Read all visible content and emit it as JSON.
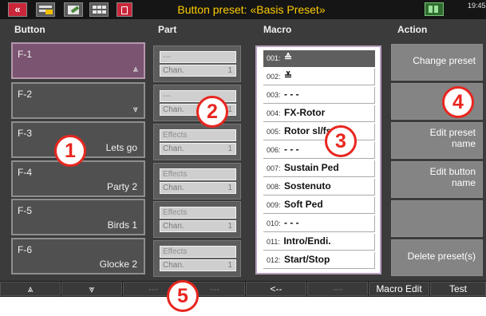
{
  "topbar": {
    "title": "Button preset: «Basis Preset»",
    "clock": "19:45",
    "back_glyph": "«",
    "icons": [
      "back-icon",
      "menu-edit-icon",
      "edit-icon",
      "grid-icon",
      "trash-icon",
      "network-icon"
    ]
  },
  "columns": {
    "button": "Button",
    "part": "Part",
    "macro": "Macro",
    "action": "Action"
  },
  "buttons": [
    {
      "name": "F-1",
      "desc": "",
      "icon": "chevron-double-up-icon",
      "glyph": "⩓",
      "selected": true
    },
    {
      "name": "F-2",
      "desc": "",
      "icon": "chevron-double-down-icon",
      "glyph": "⩔",
      "selected": false
    },
    {
      "name": "F-3",
      "desc": "Lets go"
    },
    {
      "name": "F-4",
      "desc": "Party 2"
    },
    {
      "name": "F-5",
      "desc": "Birds 1"
    },
    {
      "name": "F-6",
      "desc": "Glocke 2"
    }
  ],
  "parts": [
    {
      "top": "---",
      "label": "Chan.",
      "value": "1"
    },
    {
      "top": "---",
      "label": "Chan.",
      "value": "1"
    },
    {
      "top": "Effects",
      "label": "Chan.",
      "value": "1"
    },
    {
      "top": "Effects",
      "label": "Chan.",
      "value": "1"
    },
    {
      "top": "Effects",
      "label": "Chan.",
      "value": "1"
    },
    {
      "top": "Effects",
      "label": "Chan.",
      "value": "1"
    }
  ],
  "macros": [
    {
      "num": "001:",
      "name": "≙",
      "icon": "chevron-double-up-icon",
      "selected": true
    },
    {
      "num": "002:",
      "name": "≚",
      "icon": "chevron-double-down-icon"
    },
    {
      "num": "003:",
      "name": "- - -"
    },
    {
      "num": "004:",
      "name": "FX-Rotor"
    },
    {
      "num": "005:",
      "name": "Rotor sl/fs"
    },
    {
      "num": "006:",
      "name": "- - -"
    },
    {
      "num": "007:",
      "name": "Sustain Ped"
    },
    {
      "num": "008:",
      "name": "Sostenuto"
    },
    {
      "num": "009:",
      "name": "Soft Ped"
    },
    {
      "num": "010:",
      "name": "- - -"
    },
    {
      "num": "011:",
      "name": "Intro/Endi."
    },
    {
      "num": "012:",
      "name": "Start/Stop"
    }
  ],
  "actions": [
    {
      "line1": "Change preset",
      "line2": ""
    },
    {
      "line1": "",
      "line2": ""
    },
    {
      "line1": "Edit preset",
      "line2": "name"
    },
    {
      "line1": "Edit button",
      "line2": "name"
    },
    {
      "line1": "",
      "line2": ""
    },
    {
      "line1": "Delete preset(s)",
      "line2": ""
    }
  ],
  "bottombar": [
    {
      "label": "⩓",
      "icon": "chevron-double-up-icon",
      "enabled": true
    },
    {
      "label": "⩔",
      "icon": "chevron-double-down-icon",
      "enabled": true
    },
    {
      "label": "---",
      "enabled": false
    },
    {
      "label": "---",
      "enabled": false
    },
    {
      "label": "<--",
      "enabled": true
    },
    {
      "label": "---",
      "enabled": false
    },
    {
      "label": "Macro Edit",
      "enabled": true
    },
    {
      "label": "Test",
      "enabled": true
    }
  ],
  "callouts": [
    "1",
    "2",
    "3",
    "4",
    "5"
  ],
  "colors": {
    "title": "#ffcc00",
    "selected_button": "#7a5470",
    "callout": "#e8261f",
    "background": "#3b3b3b"
  }
}
